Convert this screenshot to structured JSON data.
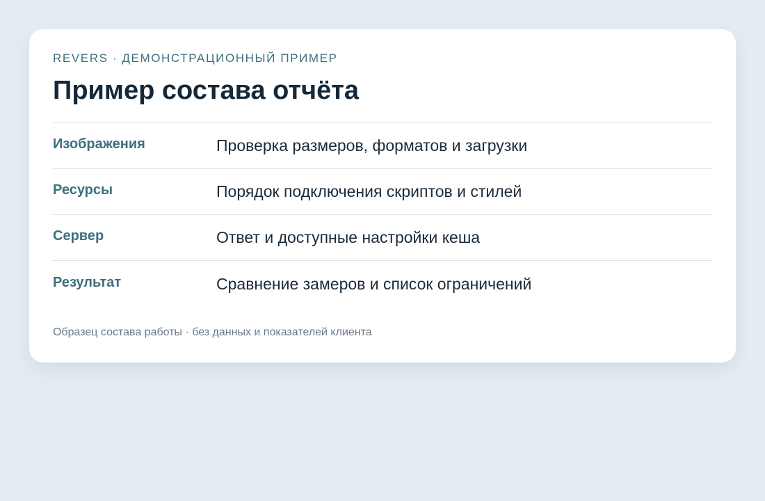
{
  "header": {
    "eyebrow": "REVERS · ДЕМОНСТРАЦИОННЫЙ ПРИМЕР",
    "title": "Пример состава отчёта"
  },
  "rows": [
    {
      "label": "Изображения",
      "value": "Проверка размеров, форматов и загрузки"
    },
    {
      "label": "Ресурсы",
      "value": "Порядок подключения скриптов и стилей"
    },
    {
      "label": "Сервер",
      "value": "Ответ и доступные настройки кеша"
    },
    {
      "label": "Результат",
      "value": "Сравнение замеров и список ограничений"
    }
  ],
  "footnote": "Образец состава работы · без данных и показателей клиента",
  "colors": {
    "background": "#e6ecf3",
    "card": "#ffffff",
    "accent": "#3e6f7d",
    "title": "#14283a",
    "muted": "#6b7a88"
  }
}
